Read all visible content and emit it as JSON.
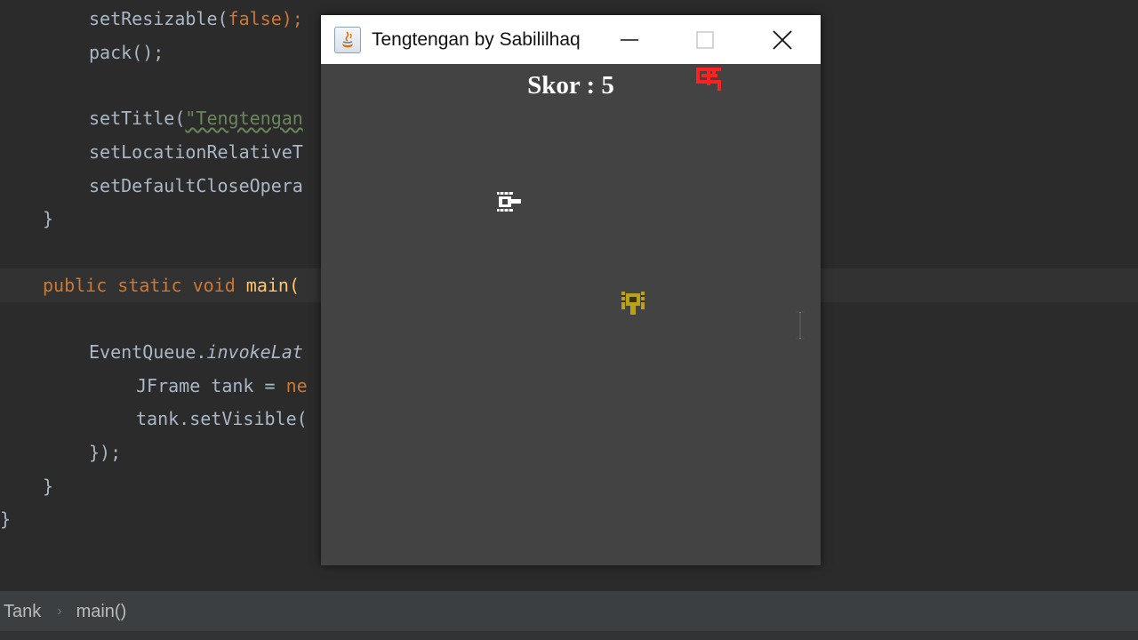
{
  "editor": {
    "lines": [
      {
        "parts": [
          {
            "t": "setResizable(",
            "c": ""
          },
          {
            "t": "false",
            "c": "tok-kw"
          },
          {
            "t": ");",
            "c": "tok-semi"
          }
        ]
      },
      {
        "parts": [
          {
            "t": "pack();",
            "c": ""
          }
        ]
      },
      {
        "parts": [
          {
            "t": "setTitle(",
            "c": ""
          },
          {
            "t": "\"Tengtengan",
            "c": "tok-str squiggle"
          }
        ]
      },
      {
        "parts": [
          {
            "t": "setLocationRelativeT",
            "c": ""
          }
        ]
      },
      {
        "parts": [
          {
            "t": "setDefaultCloseOpera",
            "c": ""
          }
        ]
      },
      {
        "parts": [
          {
            "t": "}",
            "c": "fold-brace"
          }
        ]
      },
      {
        "parts": [
          {
            "t": "public static void ",
            "c": "tok-kw"
          },
          {
            "t": "main(",
            "c": "tok-fn"
          }
        ]
      },
      {
        "parts": [
          {
            "t": "EventQueue.",
            "c": ""
          },
          {
            "t": "invokeLat",
            "c": "tok-it"
          }
        ]
      },
      {
        "parts": [
          {
            "t": "JFrame tank = ",
            "c": ""
          },
          {
            "t": "ne",
            "c": "tok-kw"
          }
        ]
      },
      {
        "parts": [
          {
            "t": "tank.setVisible(",
            "c": ""
          }
        ]
      },
      {
        "parts": [
          {
            "t": "});",
            "c": ""
          }
        ]
      },
      {
        "parts": [
          {
            "t": "}",
            "c": "fold-brace"
          }
        ]
      },
      {
        "parts": [
          {
            "t": "}",
            "c": "fold-brace"
          }
        ]
      }
    ]
  },
  "breadcrumb": {
    "items": [
      "Tank",
      "main()"
    ]
  },
  "window": {
    "title": "Tengtengan by Sabililhaq",
    "icon": "java-coffee-icon",
    "controls": {
      "minimize_icon": "minimize-icon",
      "maximize_icon": "maximize-icon",
      "close_icon": "close-icon"
    }
  },
  "game": {
    "score_text": "Skor : 5",
    "colors": {
      "background": "#434343",
      "enemy": "#ff2020",
      "player": "#ffffff",
      "obstacle": "#b8a21a"
    },
    "sprites": [
      "enemy-tank-icon",
      "player-tank-icon",
      "yellow-tank-icon"
    ]
  }
}
